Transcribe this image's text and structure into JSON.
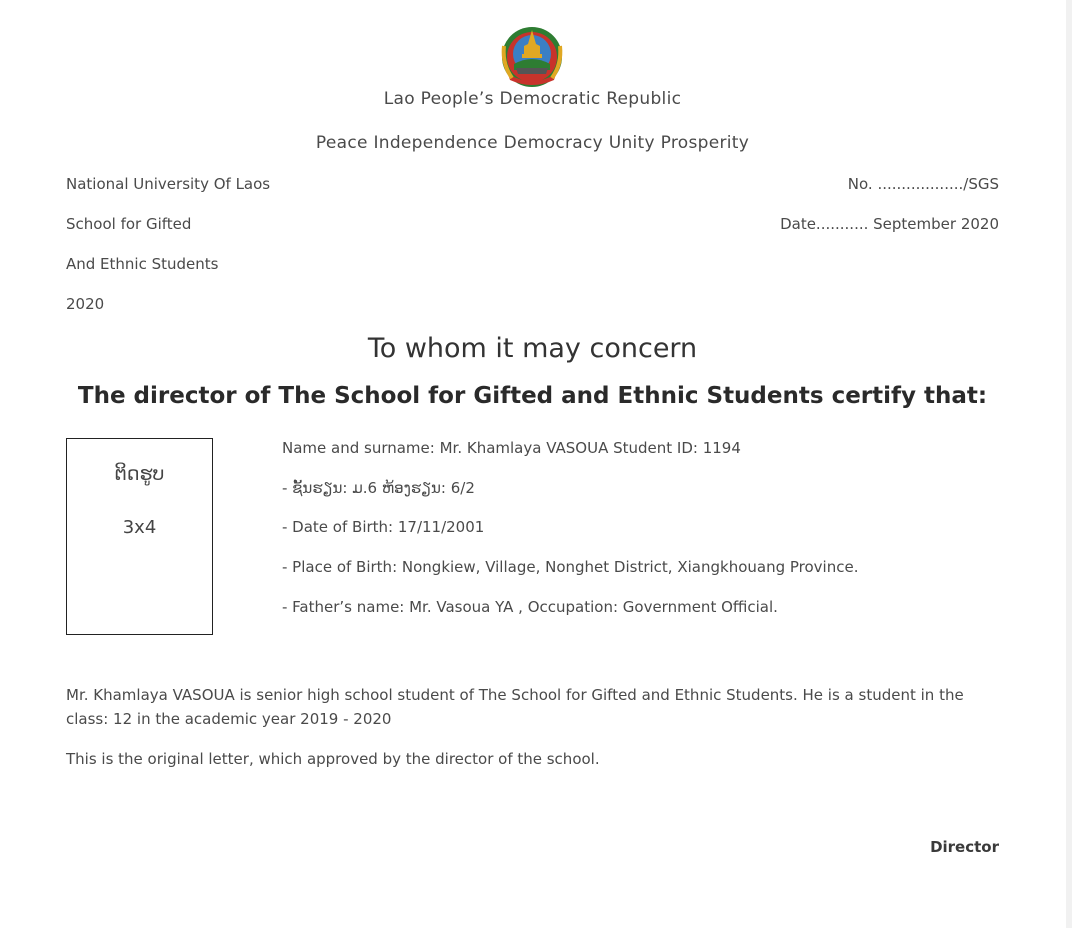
{
  "header": {
    "country": "Lao People’s Democratic Republic",
    "motto": "Peace Independence Democracy Unity Prosperity"
  },
  "issuer": {
    "line1": "National University Of Laos",
    "line2": "School for Gifted",
    "line3": "And Ethnic Students",
    "line4": "2020"
  },
  "reference": {
    "number": "No. ................../SGS",
    "date": "Date........... September 2020"
  },
  "title": "To whom it may concern",
  "certify_line": "The director of The School for Gifted and Ethnic Students certify that:",
  "photo": {
    "label": "ຕິດຮູບ",
    "size": "3x4"
  },
  "student_info": {
    "name": "Name and surname: Mr. Khamlaya VASOUA Student ID: 1194",
    "class": "- ຊັ້ນຮຽນ: ມ.6 ຫ້ອງຮຽນ: 6/2",
    "dob": "- Date of Birth: 17/11/2001",
    "pob": "- Place of Birth: Nongkiew, Village, Nonghet District, Xiangkhouang Province.",
    "father": "- Father’s name: Mr. Vasoua YA , Occupation: Government Official."
  },
  "body": {
    "paragraph1": "Mr. Khamlaya VASOUA is senior high school student of The School for Gifted and Ethnic Students. He is a student in the class: 12 in the academic year 2019 - 2020",
    "paragraph2": "This is the original letter, which approved by the director of the school."
  },
  "signature": {
    "title": "Director"
  },
  "emblem_icon": "lao-national-emblem-icon",
  "colors": {
    "emblem_red": "#c8332b",
    "emblem_green": "#2e7d32",
    "emblem_gold": "#e0a823"
  }
}
